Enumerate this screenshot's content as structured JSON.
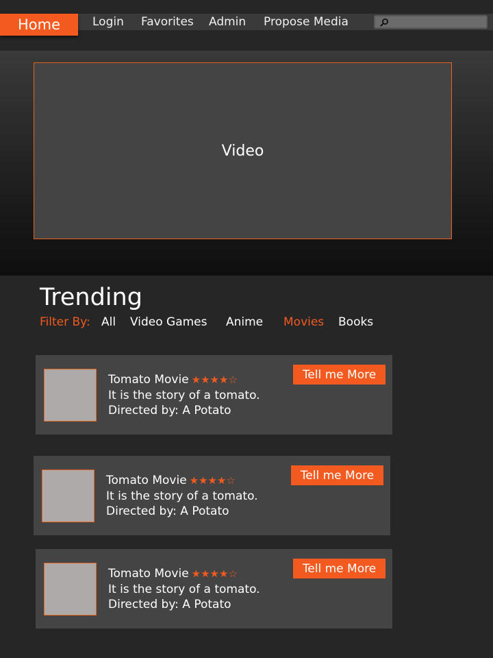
{
  "nav": {
    "home_label": "Home",
    "links": [
      "Login",
      "Favorites",
      "Admin",
      "Propose Media"
    ],
    "search_placeholder": "",
    "accent_color": "#f25a1f"
  },
  "hero": {
    "video_label": "Video"
  },
  "trending": {
    "title": "Trending",
    "filter_label": "Filter By:",
    "filters": [
      "All",
      "Video Games",
      "Anime",
      "Movies",
      "Books"
    ],
    "active_filter": "Movies",
    "items": [
      {
        "title": "Tomato Movie",
        "rating_stars": "★★★★☆",
        "rating": 4,
        "rating_max": 5,
        "description": "It is the story of a tomato.",
        "director": "Directed by: A Potato",
        "button_label": "Tell me More"
      },
      {
        "title": "Tomato Movie",
        "rating_stars": "★★★★☆",
        "rating": 4,
        "rating_max": 5,
        "description": "It is the story of a tomato.",
        "director": "Directed by: A Potato",
        "button_label": "Tell me More"
      },
      {
        "title": "Tomato Movie",
        "rating_stars": "★★★★☆",
        "rating": 4,
        "rating_max": 5,
        "description": "It is the story of a tomato.",
        "director": "Directed by: A Potato",
        "button_label": "Tell me More"
      }
    ]
  }
}
